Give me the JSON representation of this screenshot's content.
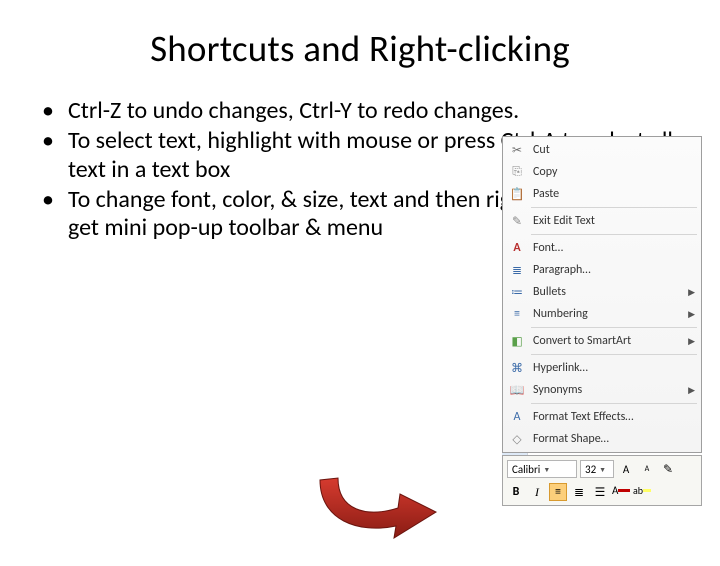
{
  "title": "Shortcuts and Right-clicking",
  "bullets": [
    "Ctrl-Z to undo changes, Ctrl-Y to redo changes.",
    "To select text, highlight with mouse or press Ctrl-A to select all text in a text box",
    "To change font, color, & size, text and then right–click on it to get mini pop-up toolbar & menu"
  ],
  "context_menu": {
    "items": [
      {
        "icon": "✂",
        "label": "Cut",
        "cls": "cut"
      },
      {
        "icon": "⎘",
        "label": "Copy",
        "cls": "copy"
      },
      {
        "icon": "📋",
        "label": "Paste",
        "cls": "paste"
      },
      {
        "sep": true
      },
      {
        "icon": "✎",
        "label": "Exit Edit Text",
        "cls": "exit"
      },
      {
        "sep": true
      },
      {
        "icon": "A",
        "label": "Font…",
        "cls": "fontA"
      },
      {
        "icon": "≣",
        "label": "Paragraph…",
        "cls": "para"
      },
      {
        "icon": "≔",
        "label": "Bullets",
        "cls": "bull",
        "sub": true
      },
      {
        "icon": "≡",
        "label": "Numbering",
        "cls": "numb",
        "sub": true
      },
      {
        "sep": true
      },
      {
        "icon": "◧",
        "label": "Convert to SmartArt",
        "cls": "smart",
        "sub": true
      },
      {
        "sep": true
      },
      {
        "icon": "⌘",
        "label": "Hyperlink…",
        "cls": "hyper"
      },
      {
        "icon": "📖",
        "label": "Synonyms",
        "cls": "syn",
        "sub": true
      },
      {
        "sep": true
      },
      {
        "icon": "A",
        "label": "Format Text Effects…",
        "cls": "tfx"
      },
      {
        "icon": "◇",
        "label": "Format Shape…",
        "cls": "shp"
      }
    ]
  },
  "mini_toolbar": {
    "font_name": "Calibri",
    "font_size": "32",
    "bold": "B",
    "italic": "I"
  }
}
